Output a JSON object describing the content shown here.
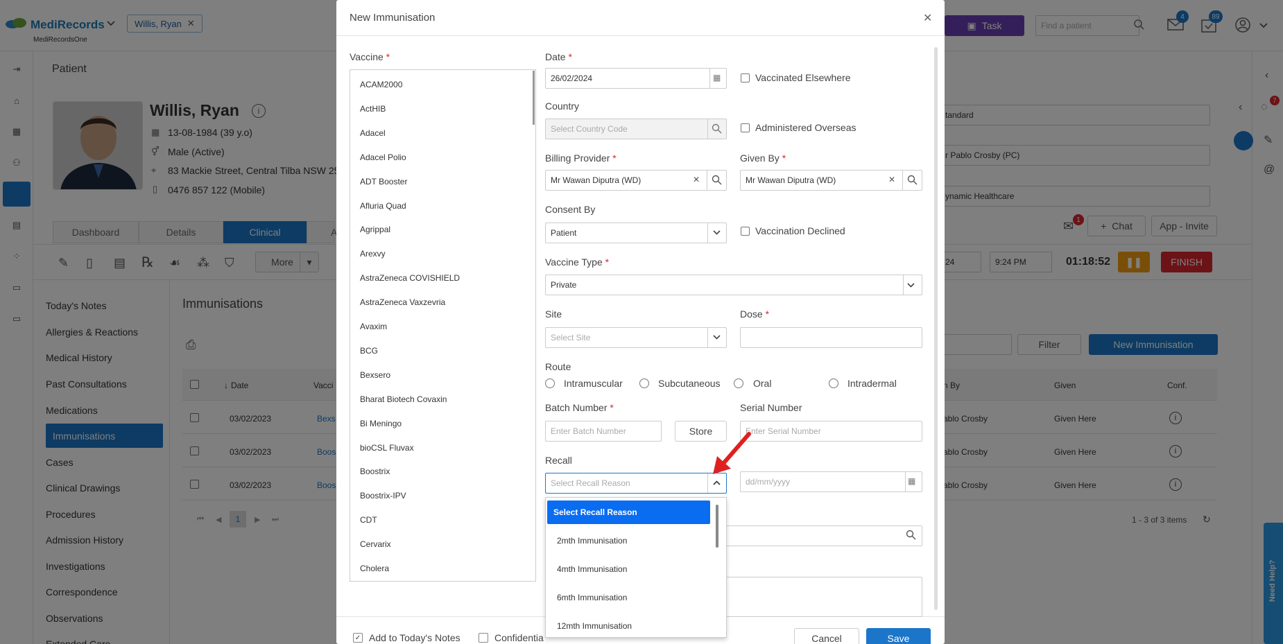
{
  "app": {
    "logo": "MediRecords",
    "logo_sub": "MediRecordsOne",
    "patient_chip": "Willis, Ryan",
    "task_label": "Task",
    "search_placeholder": "Find a patient",
    "mail_badge": "4",
    "tasks_badge": "89",
    "accent": "#1b76c9",
    "purple": "#6b3fb5"
  },
  "page": {
    "title": "Patient",
    "patient_name": "Willis, Ryan",
    "dob": "13-08-1984 (39 y.o)",
    "gender": "Male (Active)",
    "address": "83 Mackie Street, Central Tilba NSW 25",
    "phone": "0476 857 122 (Mobile)",
    "tabs": [
      "Dashboard",
      "Details",
      "Clinical",
      "A"
    ],
    "more_label": "More",
    "right_fields": [
      "tandard",
      "r Pablo Crosby (PC)",
      "ynamic Healthcare"
    ],
    "chat_label": "Chat",
    "invite_label": "App - Invite",
    "msg_badge": "1",
    "time_date": "24",
    "time_value": "9:24 PM",
    "timer": "01:18:52",
    "finish_label": "FINISH",
    "filter_label": "Filter",
    "new_immunisation_label": "New Immunisation",
    "section_title": "Immunisations",
    "pager_page": "1",
    "pager_info": "1 - 3 of 3 items",
    "help_label": "Need Help?",
    "side_badge": "7"
  },
  "left_nav": [
    "Today's Notes",
    "Allergies & Reactions",
    "Medical History",
    "Past Consultations",
    "Medications",
    "Immunisations",
    "Cases",
    "Clinical Drawings",
    "Procedures",
    "Admission History",
    "Investigations",
    "Correspondence",
    "Observations",
    "Extended Care"
  ],
  "table": {
    "headers": {
      "date": "Date",
      "vaccine": "Vacci",
      "given_by": "n By",
      "given": "Given",
      "conf": "Conf."
    },
    "rows": [
      {
        "date": "03/02/2023",
        "vaccine": "Bexs",
        "given_by": "ablo Crosby",
        "given": "Given Here"
      },
      {
        "date": "03/02/2023",
        "vaccine": "Boos",
        "given_by": "ablo Crosby",
        "given": "Given Here"
      },
      {
        "date": "03/02/2023",
        "vaccine": "Boos",
        "given_by": "ablo Crosby",
        "given": "Given Here"
      }
    ]
  },
  "modal": {
    "title": "New Immunisation",
    "vaccine_label": "Vaccine",
    "vaccines": [
      "ACAM2000",
      "ActHIB",
      "Adacel",
      "Adacel Polio",
      "ADT Booster",
      "Afluria Quad",
      "Agrippal",
      "Arexvy",
      "AstraZeneca COVISHIELD",
      "AstraZeneca Vaxzevria",
      "Avaxim",
      "BCG",
      "Bexsero",
      "Bharat Biotech Covaxin",
      "Bi Meningo",
      "bioCSL Fluvax",
      "Boostrix",
      "Boostrix-IPV",
      "CDT",
      "Cervarix",
      "Cholera"
    ],
    "date_label": "Date",
    "date_value": "26/02/2024",
    "vaccinated_elsewhere": "Vaccinated Elsewhere",
    "country_label": "Country",
    "country_placeholder": "Select Country Code",
    "administered_overseas": "Administered Overseas",
    "billing_label": "Billing Provider",
    "billing_value": "Mr Wawan Diputra (WD)",
    "given_by_label": "Given By",
    "given_by_value": "Mr Wawan Diputra (WD)",
    "consent_label": "Consent By",
    "consent_value": "Patient",
    "declined_label": "Vaccination Declined",
    "type_label": "Vaccine Type",
    "type_value": "Private",
    "site_label": "Site",
    "site_placeholder": "Select Site",
    "dose_label": "Dose",
    "route_label": "Route",
    "routes": [
      "Intramuscular",
      "Subcutaneous",
      "Oral",
      "Intradermal"
    ],
    "batch_label": "Batch Number",
    "batch_placeholder": "Enter Batch Number",
    "store_label": "Store",
    "serial_label": "Serial Number",
    "serial_placeholder": "Enter Serial Number",
    "recall_label": "Recall",
    "recall_placeholder": "Select Recall Reason",
    "recall_date_placeholder": "dd/mm/yyyy",
    "recall_options": [
      "Select Recall Reason",
      "2mth Immunisation",
      "4mth Immunisation",
      "6mth Immunisation",
      "12mth Immunisation"
    ],
    "add_notes_label": "Add to Today's Notes",
    "confidential_label": "Confidentia",
    "cancel_label": "Cancel",
    "save_label": "Save"
  }
}
